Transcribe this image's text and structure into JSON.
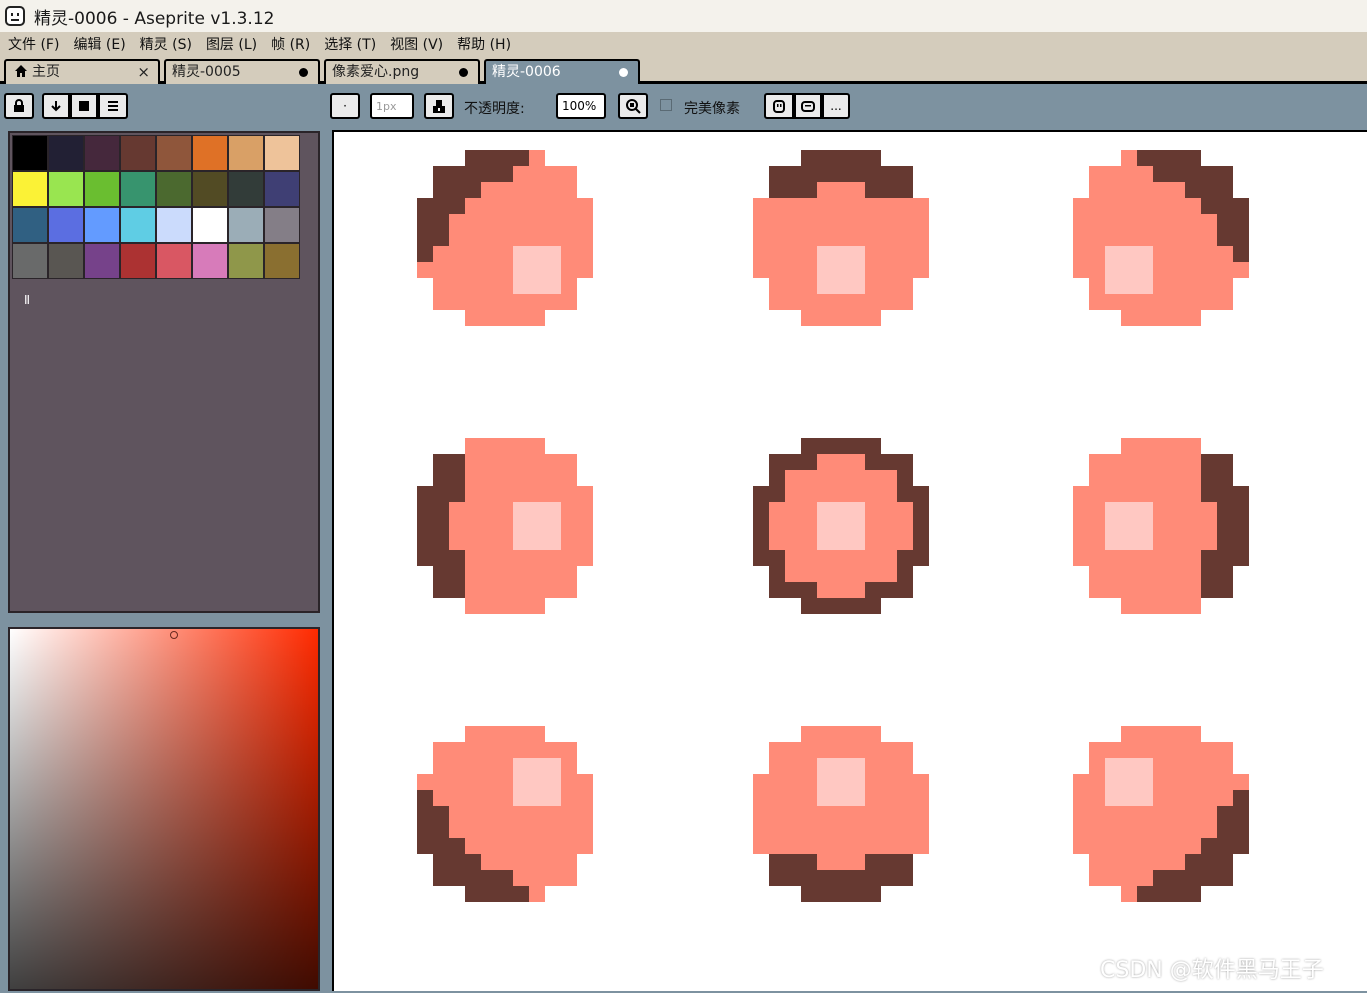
{
  "title_bar": {
    "title": "精灵-0006 - Aseprite v1.3.12",
    "icon": "aseprite-logo-icon"
  },
  "menu": [
    {
      "label": "文件 (F)"
    },
    {
      "label": "编辑 (E)"
    },
    {
      "label": "精灵 (S)"
    },
    {
      "label": "图层 (L)"
    },
    {
      "label": "帧 (R)"
    },
    {
      "label": "选择 (T)"
    },
    {
      "label": "视图 (V)"
    },
    {
      "label": "帮助 (H)"
    }
  ],
  "tabs": [
    {
      "label": "主页",
      "icon": "home-icon",
      "control": "×",
      "active": false
    },
    {
      "label": "精灵-0005",
      "active": false
    },
    {
      "label": "像素爱心.png",
      "active": false
    },
    {
      "label": "精灵-0006",
      "active": true
    }
  ],
  "toolbar": {
    "lock_icon": "lock-icon",
    "brush_type_glyph": "·",
    "brush_size": "1px",
    "opacity_label": "不透明度:",
    "opacity_value": "100%",
    "pixel_perfect_label": "完美像素",
    "pixel_perfect_checked": false,
    "more_label": "..."
  },
  "palette": {
    "colors": [
      "#000000",
      "#222034",
      "#45283c",
      "#663931",
      "#8f563b",
      "#df7126",
      "#d9a066",
      "#eec39a",
      "#fbf236",
      "#99e550",
      "#6abe30",
      "#37946e",
      "#4b692f",
      "#524b24",
      "#323c39",
      "#3f3f74",
      "#306082",
      "#5b6ee1",
      "#639bff",
      "#5fcde4",
      "#cbdbfc",
      "#ffffff",
      "#9badb7",
      "#847e87",
      "#696a6a",
      "#595652",
      "#76428a",
      "#ac3232",
      "#d95763",
      "#d77bba",
      "#8f974a",
      "#8a6f30"
    ],
    "pause_glyph": "II"
  },
  "sprite": {
    "colors": {
      "base": "#ff8b78",
      "shadow": "#663931",
      "highlight": "#ffc8c2"
    }
  },
  "watermark": "CSDN @软件黑马王子"
}
